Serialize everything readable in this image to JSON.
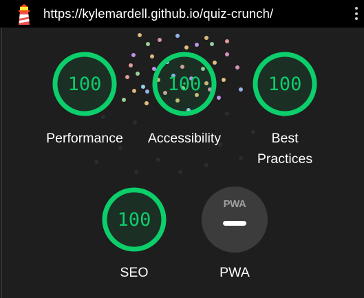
{
  "header": {
    "url": "https://kylemardell.github.io/quiz-crunch/",
    "logo_icon": "lighthouse-icon",
    "menu_icon": "kebab-menu-icon"
  },
  "colors": {
    "pass": "#0cce6b",
    "background": "#1e1e1e"
  },
  "categories": [
    {
      "id": "performance",
      "score": "100",
      "label": "Performance"
    },
    {
      "id": "accessibility",
      "score": "100",
      "label": "Accessibility"
    },
    {
      "id": "best-practices",
      "score": "100",
      "label": "Best Practices"
    },
    {
      "id": "seo",
      "score": "100",
      "label": "SEO"
    },
    {
      "id": "pwa",
      "badge": "PWA",
      "label": "PWA"
    }
  ]
}
